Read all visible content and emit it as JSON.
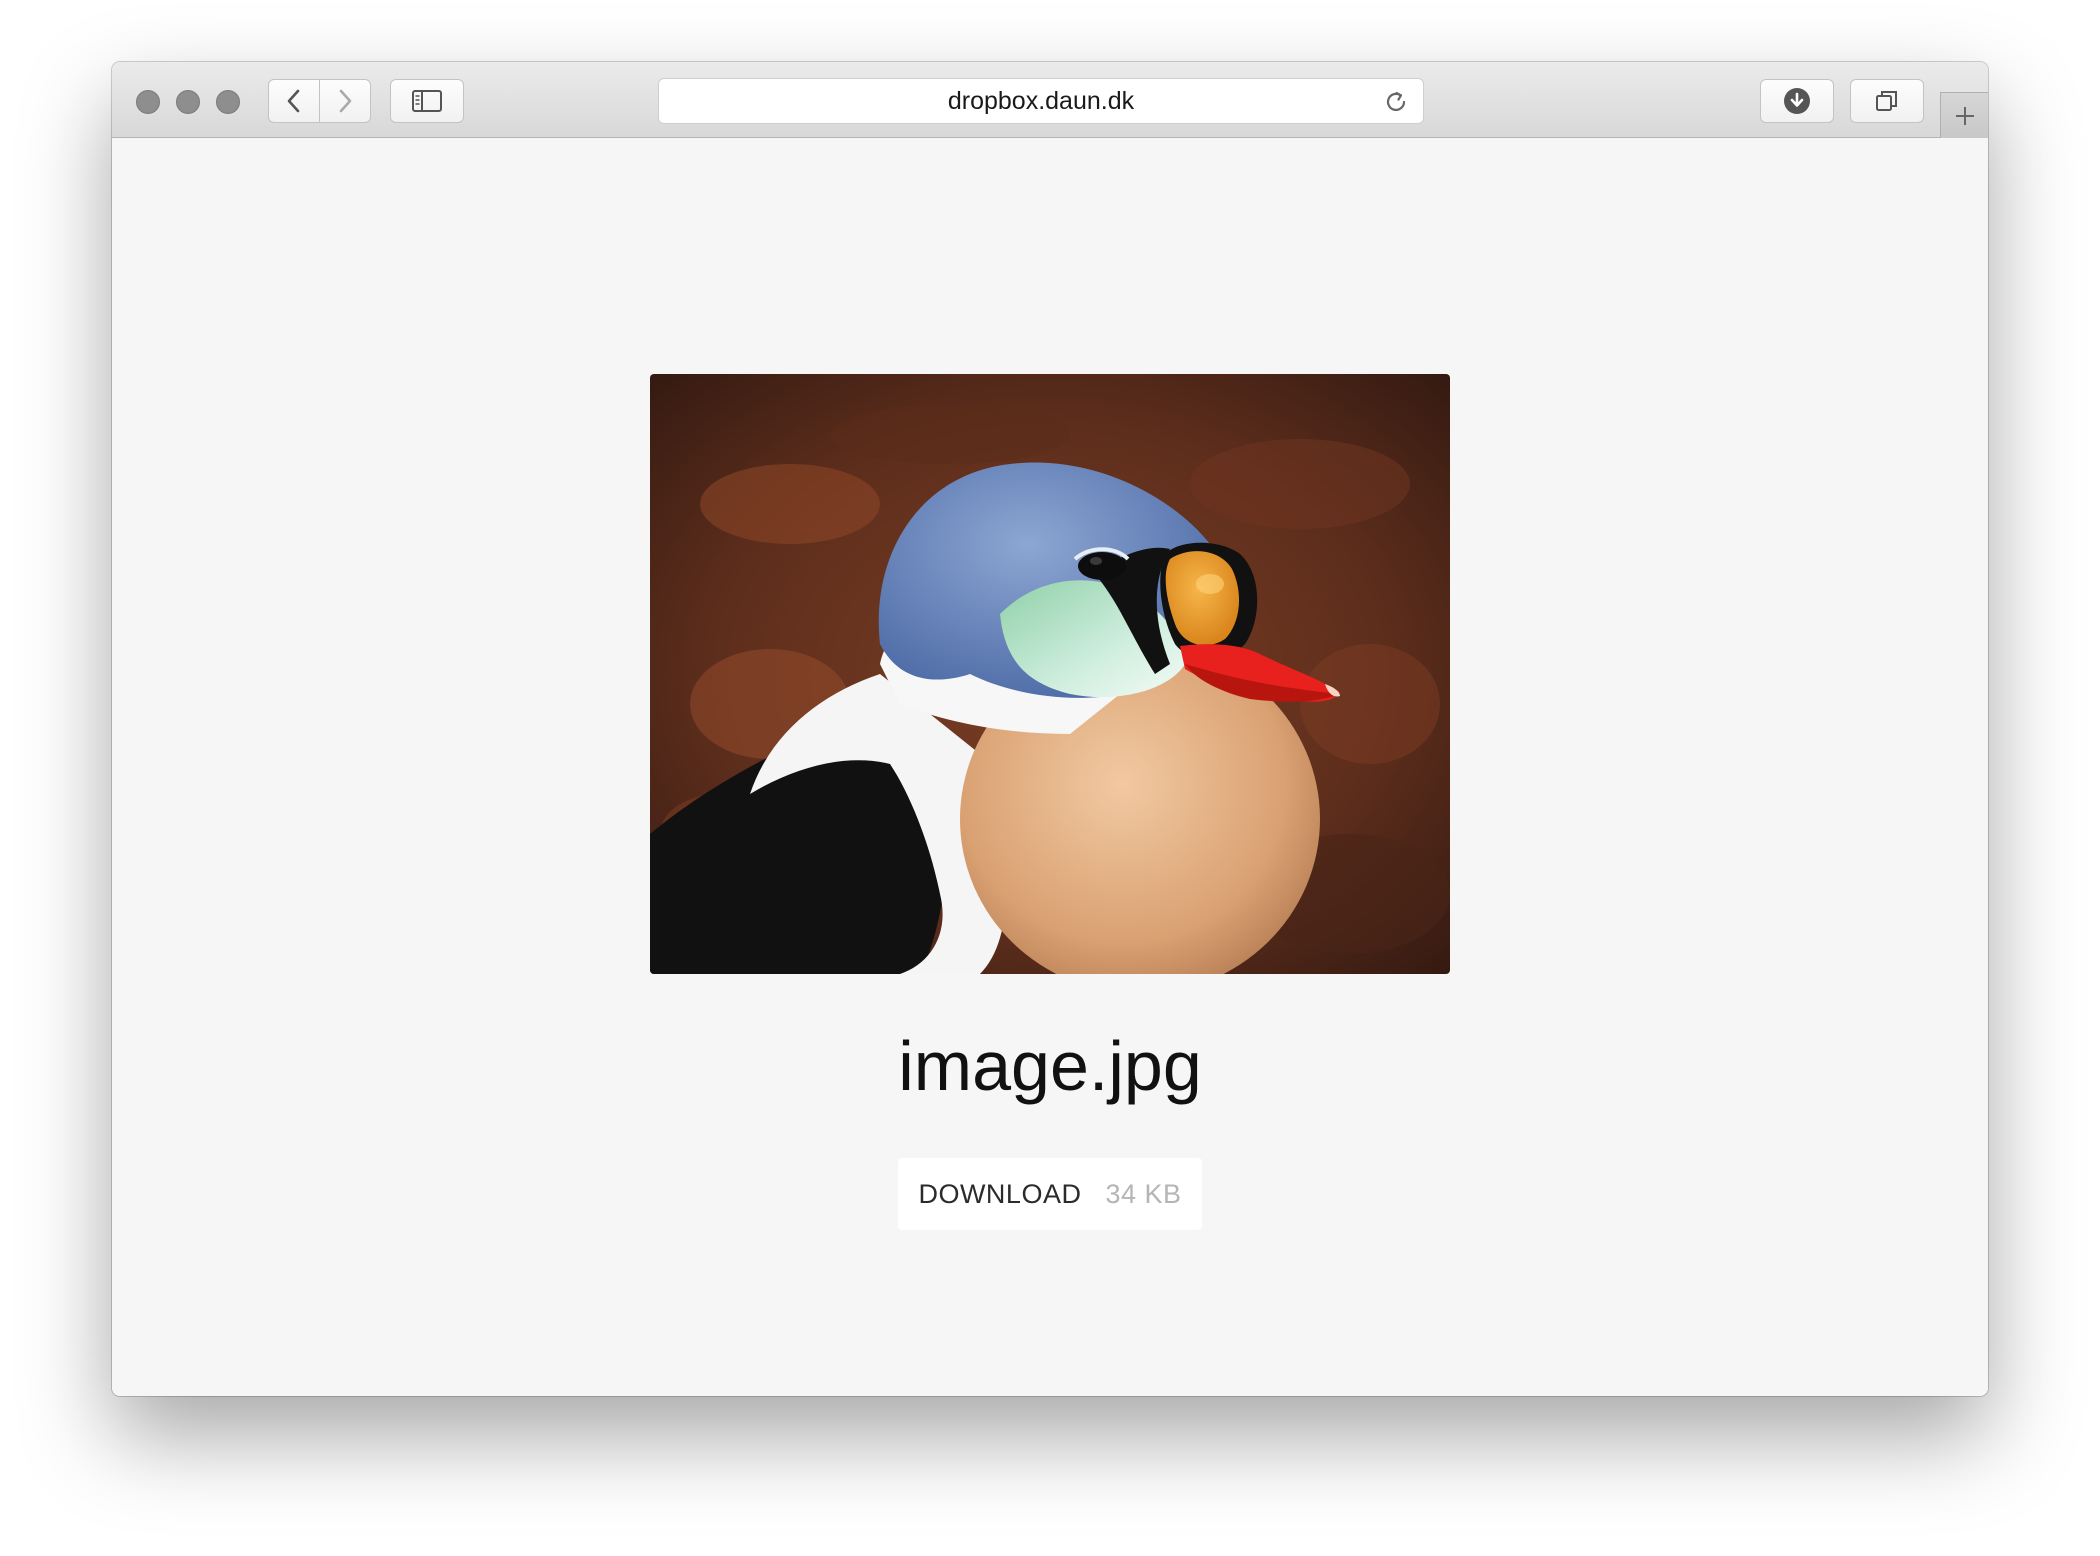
{
  "browser": {
    "url": "dropbox.daun.dk",
    "icons": {
      "back": "chevron-left-icon",
      "forward": "chevron-right-icon",
      "sidebar": "sidebar-icon",
      "reload": "reload-icon",
      "downloads": "download-icon",
      "tabs": "tab-overview-icon",
      "new_tab": "plus-icon"
    }
  },
  "file": {
    "name": "image.jpg",
    "download_label": "DOWNLOAD",
    "size": "34 KB"
  },
  "colors": {
    "page_background": "#f6f6f6",
    "button_background": "#ffffff",
    "size_text": "#b5b5b5"
  }
}
